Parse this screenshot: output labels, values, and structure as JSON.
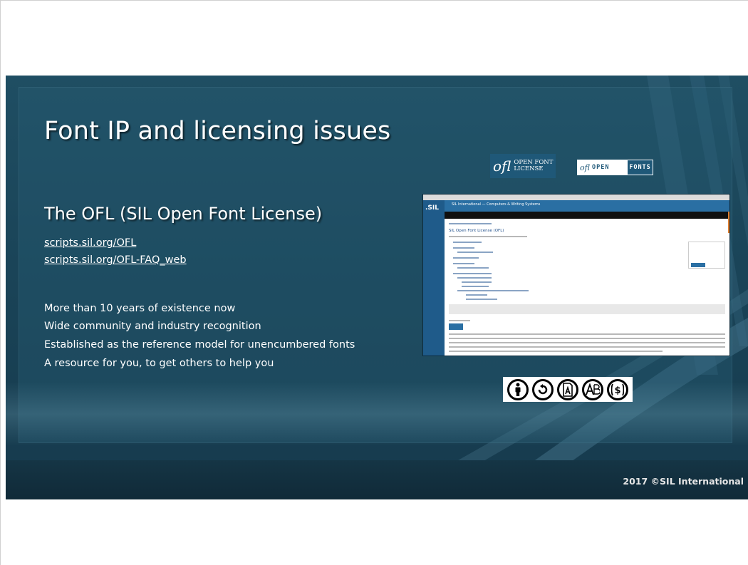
{
  "slide": {
    "title": "Font IP and licensing issues",
    "subtitle": "The OFL (SIL Open Font License)",
    "links": [
      "scripts.sil.org/OFL",
      "scripts.sil.org/OFL-FAQ_web"
    ],
    "bullets": [
      "More than 10 years of existence now",
      "Wide community and industry recognition",
      "Established as the reference model for unencumbered fonts",
      "A resource for you, to get others to help you"
    ],
    "copyright": "2017 ©SIL International"
  },
  "logos": {
    "ofl_mark": "ofl",
    "ofl_line1": "OPEN FONT",
    "ofl_line2": "LICENSE",
    "badge_ofl": "ofl",
    "badge_open": "OPEN",
    "badge_fonts": "FONTS"
  },
  "embedded_screenshot": {
    "logo": ".SIL",
    "site_title": "SIL International — Computers & Writing Systems",
    "page_heading": "SIL Open Font License (OFL)"
  },
  "icons": [
    "attribution-icon",
    "copyleft-icon",
    "font-embedding-icon",
    "modification-icon",
    "no-sale-icon"
  ],
  "colors": {
    "slide_bg": "#1a4458",
    "accent_blue": "#1f5878",
    "text": "#ffffff"
  }
}
